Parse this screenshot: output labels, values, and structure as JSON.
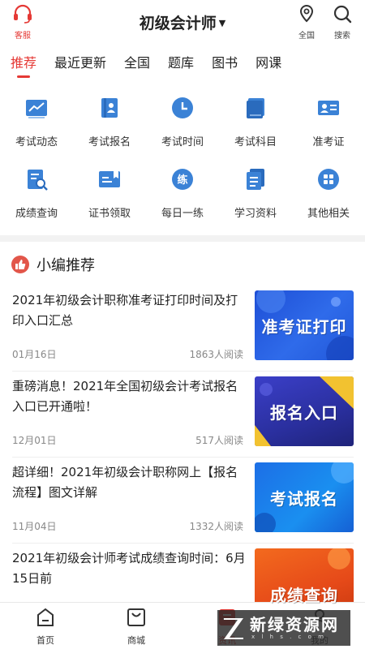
{
  "header": {
    "left_label": "客服",
    "title": "初级会计师",
    "right": [
      {
        "label": "全国",
        "icon": "location-pin-icon"
      },
      {
        "label": "搜索",
        "icon": "search-icon"
      }
    ]
  },
  "tabs": [
    "推荐",
    "最近更新",
    "全国",
    "题库",
    "图书",
    "网课"
  ],
  "grid": [
    {
      "label": "考试动态",
      "icon": "chart-trend-icon"
    },
    {
      "label": "考试报名",
      "icon": "id-badge-icon"
    },
    {
      "label": "考试时间",
      "icon": "clock-icon"
    },
    {
      "label": "考试科目",
      "icon": "book-icon"
    },
    {
      "label": "准考证",
      "icon": "id-card-icon"
    },
    {
      "label": "成绩查询",
      "icon": "document-search-icon"
    },
    {
      "label": "证书领取",
      "icon": "certificate-icon"
    },
    {
      "label": "每日一练",
      "icon": "practice-icon"
    },
    {
      "label": "学习资料",
      "icon": "documents-icon"
    },
    {
      "label": "其他相关",
      "icon": "apps-grid-icon"
    }
  ],
  "section": {
    "title": "小编推荐"
  },
  "news": [
    {
      "title": "2021年初级会计职称准考证打印时间及打印入口汇总",
      "date": "01月16日",
      "reads": "1863人阅读",
      "thumb_text": "准考证打印"
    },
    {
      "title": "重磅消息！2021年全国初级会计考试报名入口已开通啦！",
      "date": "12月01日",
      "reads": "517人阅读",
      "thumb_text": "报名入口"
    },
    {
      "title": "超详细！2021年初级会计职称网上【报名流程】图文详解",
      "date": "11月04日",
      "reads": "1332人阅读",
      "thumb_text": "考试报名"
    },
    {
      "title": "2021年初级会计师考试成绩查询时间：6月15日前",
      "date": "",
      "reads": "",
      "thumb_text": "成绩查询"
    }
  ],
  "bottom_nav": [
    {
      "label": "首页",
      "icon": "home-icon"
    },
    {
      "label": "商城",
      "icon": "shopping-bag-icon"
    },
    {
      "label": "资讯",
      "icon": "news-icon"
    },
    {
      "label": "我的",
      "icon": "profile-icon"
    }
  ],
  "watermark": {
    "text": "新绿资源网",
    "sub": "x l h s . c o m"
  },
  "colors": {
    "accent": "#e53935",
    "icon_blue": "#3b82d6"
  }
}
